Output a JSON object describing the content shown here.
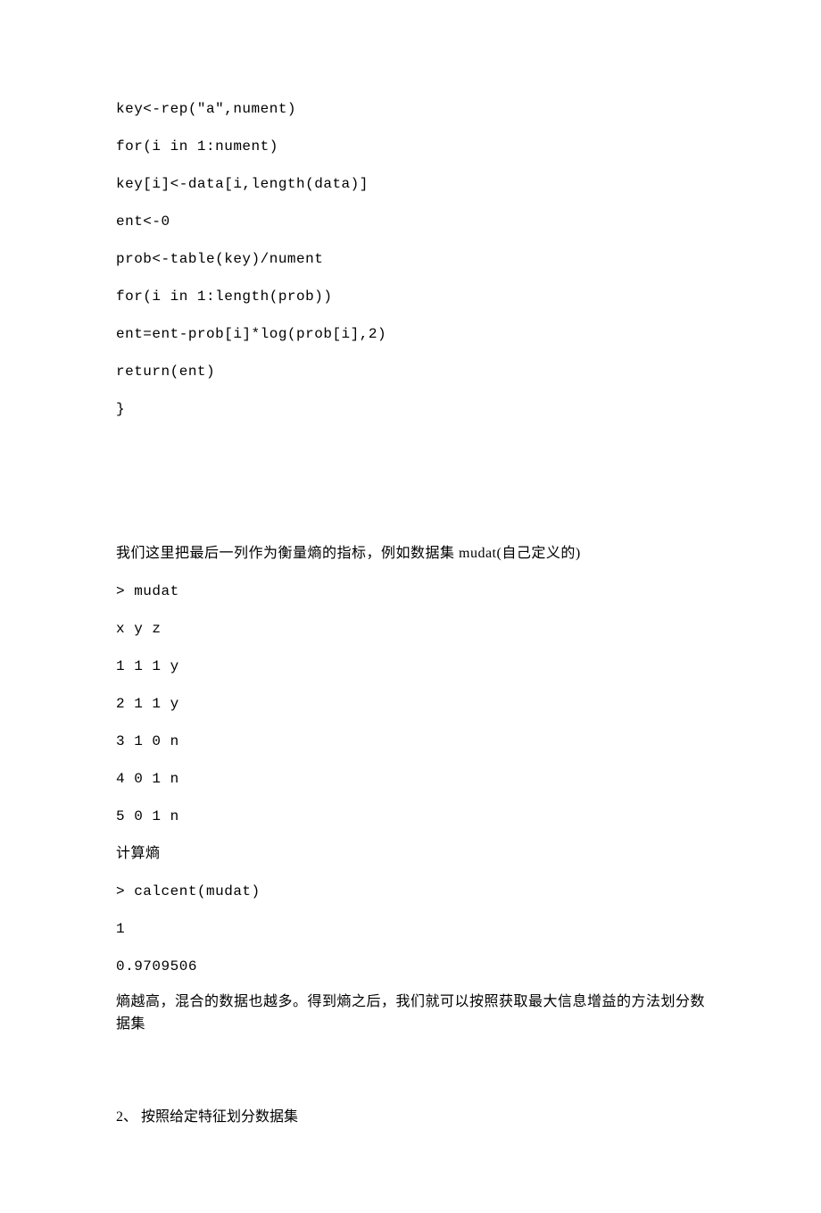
{
  "code": {
    "l1": "key<-rep(\"a\",nument)",
    "l2": "for(i in 1:nument)",
    "l3": "key[i]<-data[i,length(data)]",
    "l4": "ent<-0",
    "l5": "prob<-table(key)/nument",
    "l6": "for(i in 1:length(prob))",
    "l7": "ent=ent-prob[i]*log(prob[i],2)",
    "l8": "return(ent)",
    "l9": "}"
  },
  "para1": "我们这里把最后一列作为衡量熵的指标，例如数据集 mudat(自己定义的)",
  "mudat_cmd": "> mudat",
  "mudat_header": "x y z",
  "mudat_rows": {
    "r1": "1 1 1 y",
    "r2": "2 1 1 y",
    "r3": "3 1 0 n",
    "r4": "4 0 1 n",
    "r5": "5 0 1 n"
  },
  "calc_label": "计算熵",
  "calc_cmd": "> calcent(mudat)",
  "calc_out1": "1",
  "calc_out2": "0.9709506",
  "para2a": "熵越高，混合的数据也越多。得到熵之后，我们就可以按照获取最大信息增益的方法划分数",
  "para2b": "据集",
  "section2": "2、 按照给定特征划分数据集"
}
